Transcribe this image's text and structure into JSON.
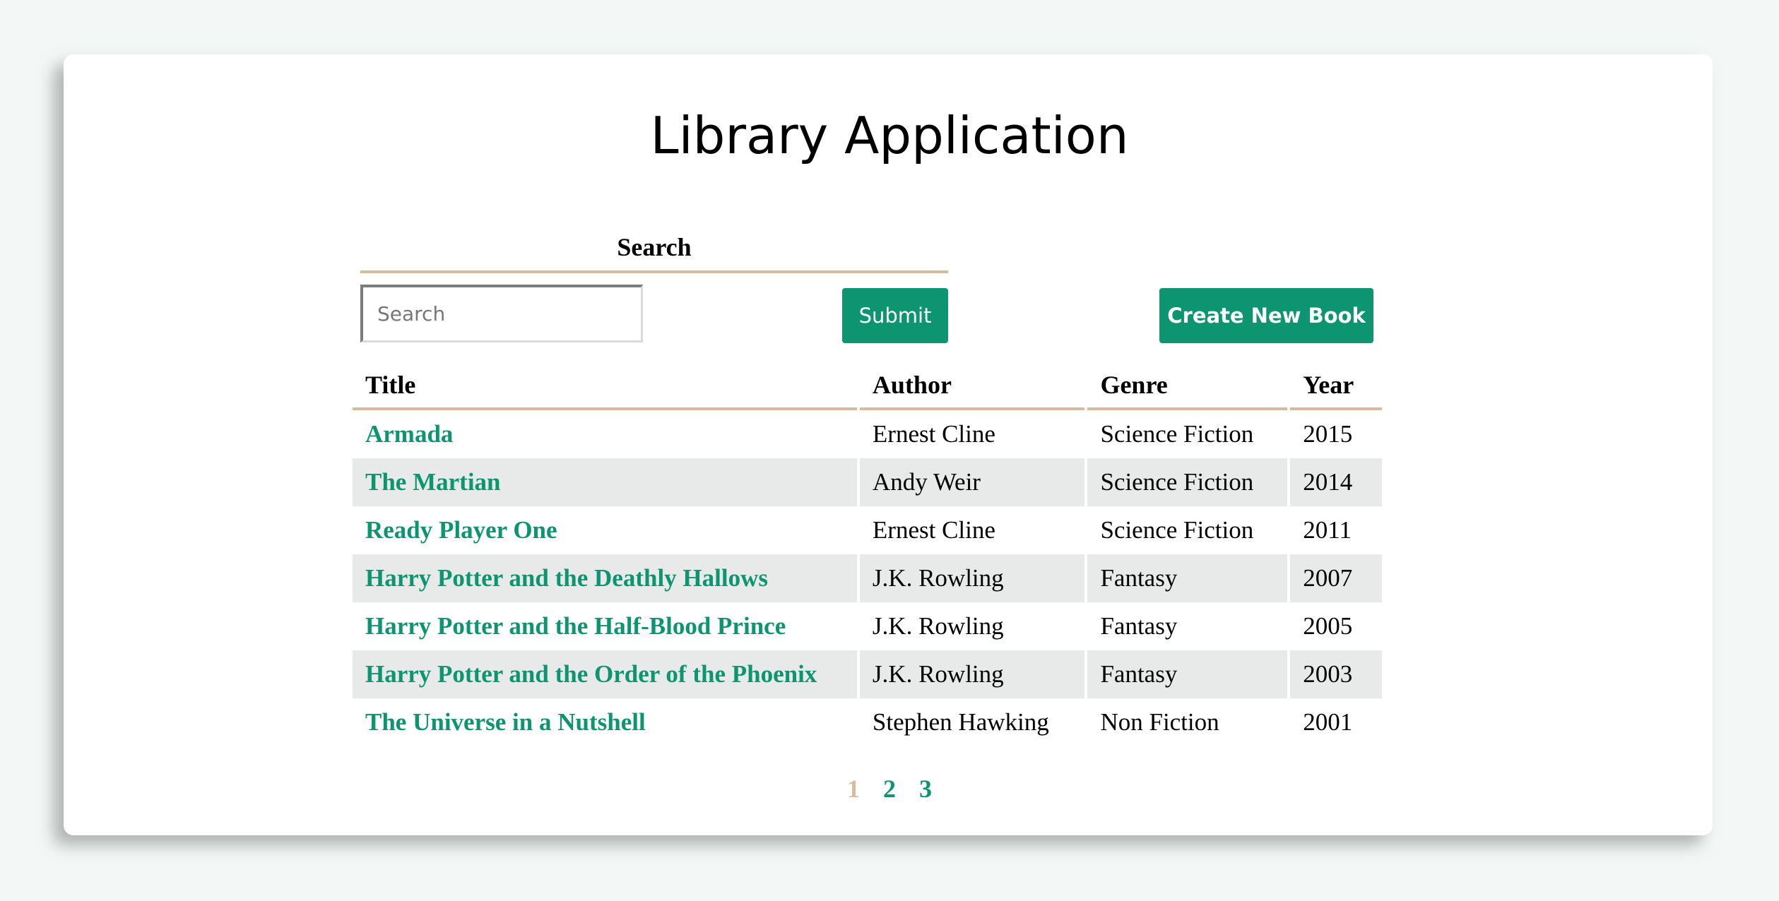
{
  "header": {
    "title": "Library Application"
  },
  "search": {
    "heading": "Search",
    "placeholder": "Search",
    "value": "",
    "submit_label": "Submit"
  },
  "toolbar": {
    "create_label": "Create New Book"
  },
  "table": {
    "columns": [
      "Title",
      "Author",
      "Genre",
      "Year"
    ],
    "rows": [
      {
        "title": "Armada",
        "author": "Ernest Cline",
        "genre": "Science Fiction",
        "year": "2015"
      },
      {
        "title": "The Martian",
        "author": "Andy Weir",
        "genre": "Science Fiction",
        "year": "2014"
      },
      {
        "title": "Ready Player One",
        "author": "Ernest Cline",
        "genre": "Science Fiction",
        "year": "2011"
      },
      {
        "title": "Harry Potter and the Deathly Hallows",
        "author": "J.K. Rowling",
        "genre": "Fantasy",
        "year": "2007"
      },
      {
        "title": "Harry Potter and the Half-Blood Prince",
        "author": "J.K. Rowling",
        "genre": "Fantasy",
        "year": "2005"
      },
      {
        "title": "Harry Potter and the Order of the Phoenix",
        "author": "J.K. Rowling",
        "genre": "Fantasy",
        "year": "2003"
      },
      {
        "title": "The Universe in a Nutshell",
        "author": "Stephen Hawking",
        "genre": "Non Fiction",
        "year": "2001"
      }
    ]
  },
  "pagination": {
    "pages": [
      "1",
      "2",
      "3"
    ],
    "current": "1"
  },
  "colors": {
    "accent": "#0d9572",
    "border_tan": "#d6bc9d",
    "row_stripe": "#e8eae9",
    "background": "#f3f7f5"
  }
}
